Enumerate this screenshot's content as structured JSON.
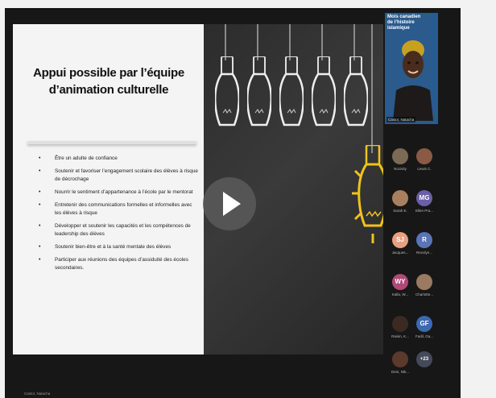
{
  "slide": {
    "title_line1": "Appui possible par l’équipe",
    "title_line2": "d’animation culturelle",
    "bullets": [
      "Être un adulte de confiance",
      "Soutenir et favoriser l’engagement scolaire des élèves à risque de décrochage",
      "Nourrir le sentiment d’appartenance à l’école par le mentorat",
      "Entretenir des communications formelles et informelles avec les élèves à risque",
      "Développer et soutenir les capacités et les compétences de leadership des élèves",
      "Soutenir bien-être et à la santé mentale des élèves",
      "Participer aux réunions des équipes d’assiduité des écoles secondaires."
    ]
  },
  "camera": {
    "title_line1": "Mois canadien",
    "title_line2": "de l’histoire islamique",
    "speaker_name": "Castor, Natacha"
  },
  "participants": [
    {
      "initials": "",
      "name": "Nocivity",
      "color": "#7b6b55"
    },
    {
      "initials": "",
      "name": "Lewis C.",
      "color": "#8a5a44"
    },
    {
      "initials": "",
      "name": "Sarah E.",
      "color": "#a88060"
    },
    {
      "initials": "MG",
      "name": "Ellen Pra...",
      "color": "#6b5fa8"
    },
    {
      "initials": "SJ",
      "name": "Jacques...",
      "color": "#e8a080"
    },
    {
      "initials": "R",
      "name": "Revolyn...",
      "color": "#5a74b8"
    },
    {
      "initials": "WY",
      "name": "Kalla, W...",
      "color": "#b04878"
    },
    {
      "initials": "",
      "name": "Charlotte...",
      "color": "#9a7a60"
    },
    {
      "initials": "",
      "name": "Raisin, K...",
      "color": "#3a2a22"
    },
    {
      "initials": "GF",
      "name": "Fadil, Ga...",
      "color": "#3a6ab0"
    },
    {
      "initials": "",
      "name": "Deni, Nik...",
      "color": "#5a3a2a"
    },
    {
      "initials": "+23",
      "name": "",
      "color": "#444a5a"
    }
  ],
  "bottom_label": "Castor, Natacha"
}
